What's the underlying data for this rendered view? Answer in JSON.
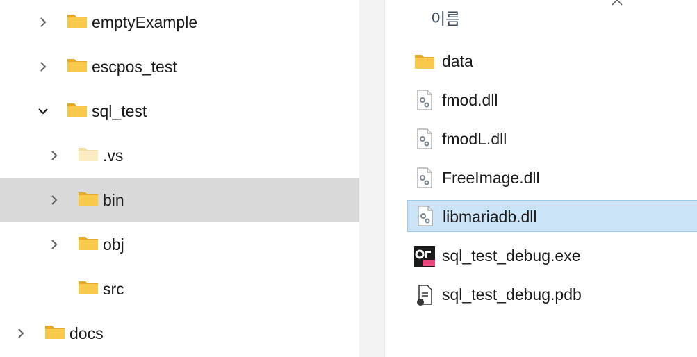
{
  "tree": {
    "items": [
      {
        "label": "emptyExample",
        "expanded": false
      },
      {
        "label": "escpos_test",
        "expanded": false
      },
      {
        "label": "sql_test",
        "expanded": true
      },
      {
        "label": ".vs",
        "expanded": false,
        "hidden_folder": true
      },
      {
        "label": "bin",
        "expanded": false,
        "selected": true
      },
      {
        "label": "obj",
        "expanded": false
      },
      {
        "label": "src"
      },
      {
        "label": "docs",
        "expanded": false
      }
    ]
  },
  "file_list": {
    "column_name": "이름",
    "files": [
      {
        "name": "data",
        "icon": "folder-icon"
      },
      {
        "name": "fmod.dll",
        "icon": "dll-file-icon"
      },
      {
        "name": "fmodL.dll",
        "icon": "dll-file-icon"
      },
      {
        "name": "FreeImage.dll",
        "icon": "dll-file-icon"
      },
      {
        "name": "libmariadb.dll",
        "icon": "dll-file-icon",
        "selected": true
      },
      {
        "name": "sql_test_debug.exe",
        "icon": "exe-app-icon"
      },
      {
        "name": "sql_test_debug.pdb",
        "icon": "pdb-file-icon"
      }
    ]
  },
  "colors": {
    "folder": "#f8c94a",
    "tree_selected": "#d9d9d9",
    "list_selected": "#cce4f7",
    "list_selected_border": "#99c9ef"
  }
}
